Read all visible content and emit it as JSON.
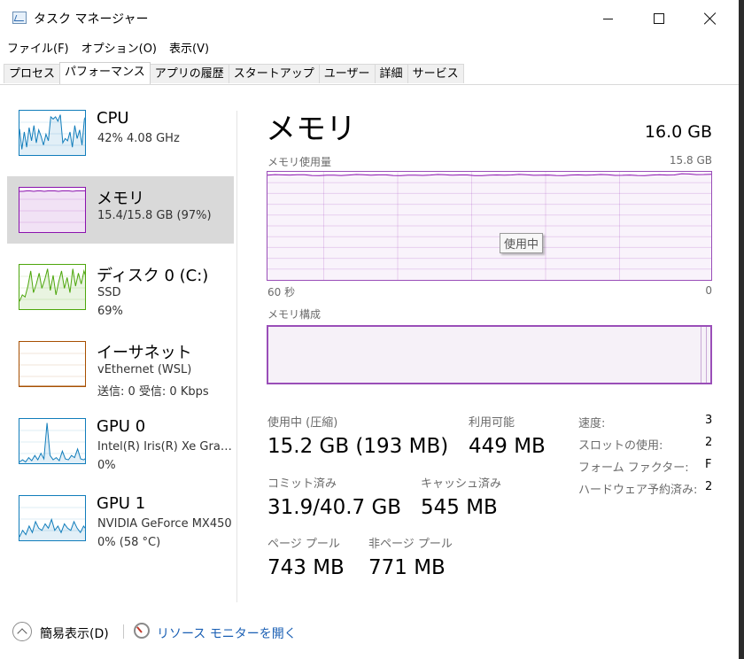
{
  "window": {
    "title": "タスク マネージャー"
  },
  "menu": [
    "ファイル(F)",
    "オプション(O)",
    "表示(V)"
  ],
  "tabs": [
    "プロセス",
    "パフォーマンス",
    "アプリの履歴",
    "スタートアップ",
    "ユーザー",
    "詳細",
    "サービス"
  ],
  "active_tab": 1,
  "sidebar": {
    "items": [
      {
        "title": "CPU",
        "sub1": "42%  4.08 GHz",
        "sub2": "",
        "color": "#117dbb"
      },
      {
        "title": "メモリ",
        "sub1": "15.4/15.8 GB (97%)",
        "sub2": "",
        "color": "#8b12ae"
      },
      {
        "title": "ディスク 0 (C:)",
        "sub1": "SSD",
        "sub2": "69%",
        "color": "#4da60c"
      },
      {
        "title": "イーサネット",
        "sub1": "vEthernet (WSL)",
        "sub2": "送信: 0  受信: 0 Kbps",
        "color": "#a74f01"
      },
      {
        "title": "GPU 0",
        "sub1": "Intel(R) Iris(R) Xe Graphics",
        "sub2": "0%",
        "color": "#117dbb"
      },
      {
        "title": "GPU 1",
        "sub1": "NVIDIA GeForce MX450",
        "sub2": "0% (58 °C)",
        "color": "#117dbb"
      }
    ],
    "selected": 1
  },
  "main": {
    "title": "メモリ",
    "total": "16.0 GB",
    "usage_label": "メモリ使用量",
    "usage_max": "15.8 GB",
    "usage_tooltip": "使用中",
    "time_left": "60 秒",
    "time_right": "0",
    "composition_label": "メモリ構成",
    "usage_fraction": 0.97
  },
  "stats": {
    "in_use_label": "使用中 (圧縮)",
    "in_use_value": "15.2 GB (193 MB)",
    "available_label": "利用可能",
    "available_value": "449 MB",
    "committed_label": "コミット済み",
    "committed_value": "31.9/40.7 GB",
    "cached_label": "キャッシュ済み",
    "cached_value": "545 MB",
    "paged_label": "ページ プール",
    "paged_value": "743 MB",
    "nonpaged_label": "非ページ プール",
    "nonpaged_value": "771 MB"
  },
  "props": [
    {
      "label": "速度:",
      "value": "3"
    },
    {
      "label": "スロットの使用:",
      "value": "2"
    },
    {
      "label": "フォーム ファクター:",
      "value": "F"
    },
    {
      "label": "ハードウェア予約済み:",
      "value": "2"
    }
  ],
  "footer": {
    "simple": "簡易表示(D)",
    "monitor": "リソース モニターを開く"
  },
  "thumb_series": {
    "cpu": [
      0.62,
      0.15,
      0.55,
      0.2,
      0.65,
      0.35,
      0.7,
      0.3,
      0.6,
      0.45,
      0.25,
      0.5,
      0.35,
      0.9,
      0.85,
      0.9,
      0.8,
      0.95,
      0.3,
      0.4,
      0.35,
      0.55,
      0.2,
      0.7,
      0.4,
      0.6,
      0.25,
      0.85,
      0.95
    ],
    "memory": [
      0.96,
      0.96,
      0.97,
      0.97,
      0.96,
      0.97,
      0.97,
      0.96,
      0.97,
      0.97,
      0.97,
      0.96,
      0.97,
      0.97,
      0.97,
      0.96,
      0.97,
      0.97,
      0.97,
      0.97
    ],
    "disk": [
      0.2,
      0.35,
      0.3,
      0.55,
      0.9,
      0.4,
      0.6,
      0.85,
      0.5,
      0.7,
      0.95,
      0.45,
      0.8,
      0.35,
      0.65,
      0.9,
      0.5,
      0.75,
      0.4,
      0.95,
      0.55,
      0.85,
      0.6,
      0.9,
      0.7
    ],
    "ethernet": [
      0.02,
      0.02,
      0.02,
      0.02,
      0.02,
      0.02,
      0.02,
      0.02,
      0.02,
      0.02,
      0.02,
      0.02,
      0.02,
      0.02,
      0.02,
      0.02,
      0.02,
      0.02,
      0.02,
      0.02
    ],
    "gpu0": [
      0.05,
      0.1,
      0.05,
      0.15,
      0.08,
      0.2,
      0.1,
      0.25,
      0.12,
      0.95,
      0.2,
      0.1,
      0.15,
      0.08,
      0.3,
      0.12,
      0.1,
      0.2,
      0.15,
      0.35,
      0.12,
      0.1,
      0.15
    ],
    "gpu1": [
      0.1,
      0.25,
      0.15,
      0.35,
      0.2,
      0.45,
      0.3,
      0.25,
      0.4,
      0.3,
      0.5,
      0.25,
      0.35,
      0.2,
      0.4,
      0.3,
      0.25,
      0.45,
      0.3,
      0.2,
      0.35,
      0.25
    ]
  }
}
